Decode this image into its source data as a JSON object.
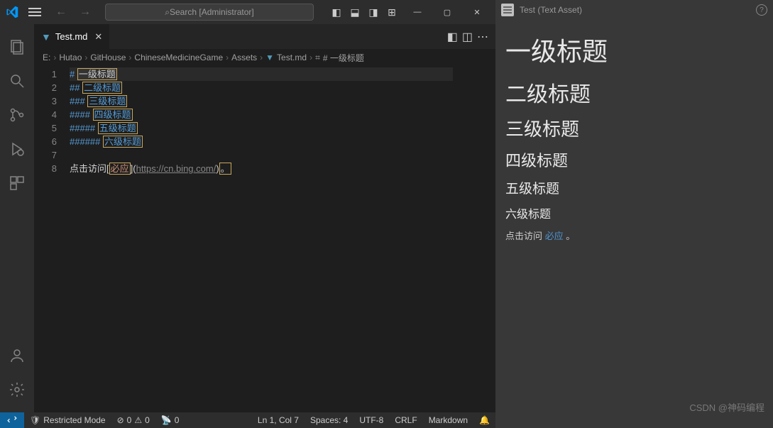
{
  "title_bar": {
    "search_placeholder": "Search [Administrator]",
    "layout_icons": [
      "panel-left",
      "panel-bottom",
      "panel-right",
      "layout"
    ]
  },
  "tab": {
    "name": "Test.md"
  },
  "breadcrumb": [
    "E:",
    "Hutao",
    "GitHouse",
    "ChineseMedicineGame",
    "Assets",
    "Test.md",
    "# 一级标题"
  ],
  "code": {
    "lines": [
      {
        "n": 1,
        "hash": "#",
        "text": "一级标题",
        "cls": "h1"
      },
      {
        "n": 2,
        "hash": "##",
        "text": "二级标题",
        "cls": "h2"
      },
      {
        "n": 3,
        "hash": "###",
        "text": "三级标题",
        "cls": "h3"
      },
      {
        "n": 4,
        "hash": "####",
        "text": "四级标题",
        "cls": "h4"
      },
      {
        "n": 5,
        "hash": "#####",
        "text": "五级标题",
        "cls": "h5"
      },
      {
        "n": 6,
        "hash": "######",
        "text": "六级标题",
        "cls": "h6"
      },
      {
        "n": 7,
        "hash": "",
        "text": "",
        "cls": ""
      },
      {
        "n": 8,
        "prefix": "点击访问[",
        "label": "必应",
        "mid": "](",
        "url": "https://cn.bing.com/",
        "suffix": ")",
        "end": "。"
      }
    ]
  },
  "status": {
    "restricted": "Restricted Mode",
    "errors": "0",
    "warnings": "0",
    "ports": "0",
    "position": "Ln 1, Col 7",
    "spaces": "Spaces: 4",
    "encoding": "UTF-8",
    "eol": "CRLF",
    "language": "Markdown"
  },
  "right": {
    "title": "Test (Text Asset)",
    "h1": "一级标题",
    "h2": "二级标题",
    "h3": "三级标题",
    "h4": "四级标题",
    "h5": "五级标题",
    "h6": "六级标题",
    "p_prefix": "点击访问 ",
    "link_text": "必应",
    "p_suffix": " 。"
  },
  "watermark": "CSDN @神码编程"
}
